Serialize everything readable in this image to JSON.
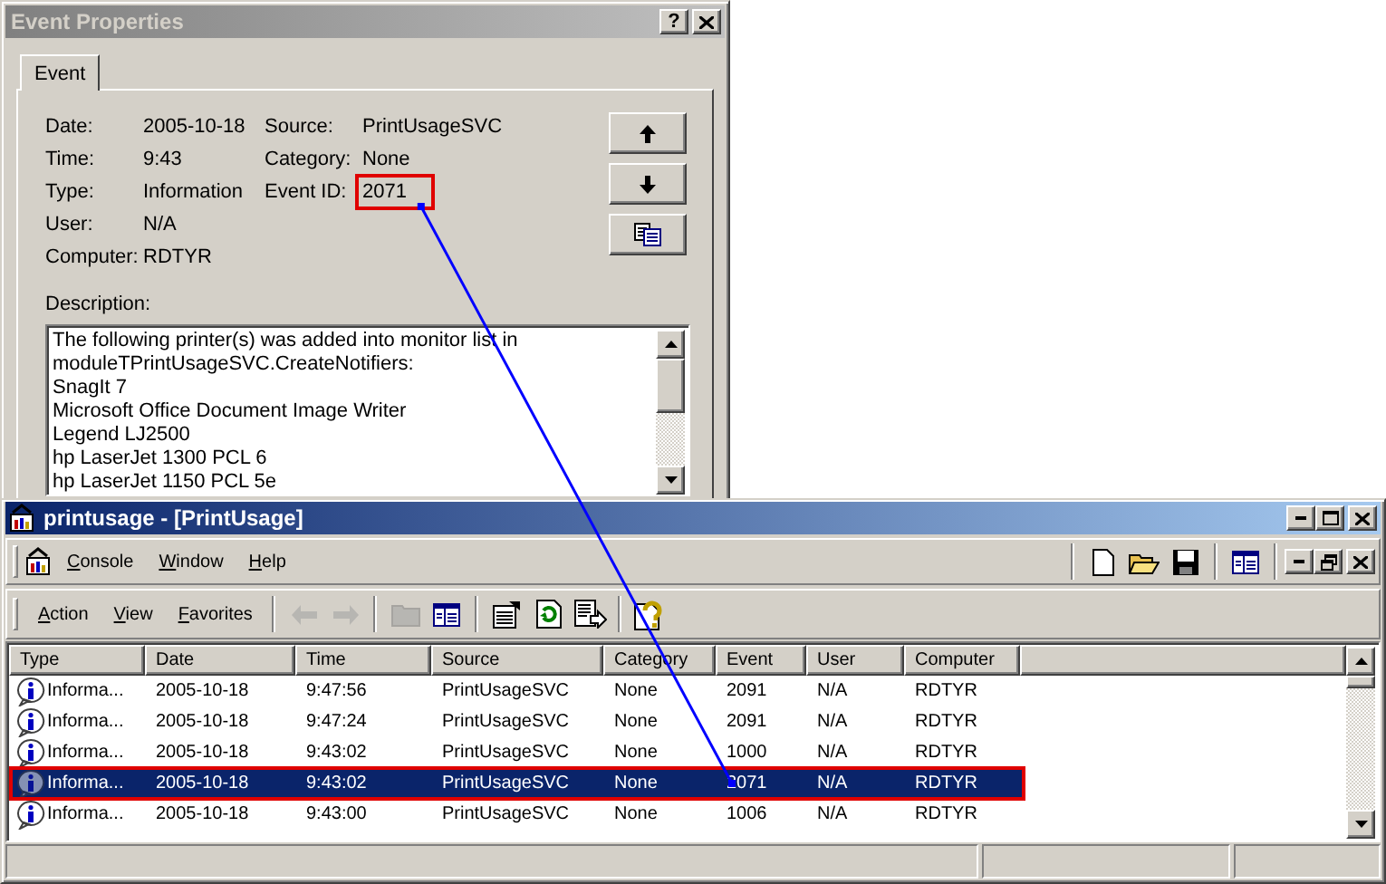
{
  "event_dialog": {
    "title": "Event Properties",
    "help_button": "?",
    "tabs": [
      {
        "label": "Event",
        "selected": true
      }
    ],
    "left_fields": [
      {
        "label": "Date:",
        "value": "2005-10-18",
        "highlighted": false
      },
      {
        "label": "Time:",
        "value": "9:43",
        "highlighted": false
      },
      {
        "label": "Type:",
        "value": "Information",
        "highlighted": false
      },
      {
        "label": "User:",
        "value": "N/A",
        "highlighted": false
      },
      {
        "label": "Computer:",
        "value": "RDTYR",
        "highlighted": false
      }
    ],
    "right_fields": [
      {
        "label": "Source:",
        "value": "PrintUsageSVC",
        "highlighted": false
      },
      {
        "label": "Category:",
        "value": "None",
        "highlighted": false
      },
      {
        "label": "Event ID:",
        "value": "2071",
        "highlighted": true
      }
    ],
    "side_buttons": [
      {
        "kind": "up"
      },
      {
        "kind": "down"
      },
      {
        "kind": "copy"
      }
    ],
    "description_label": "Description:",
    "description_lines": [
      "The following printer(s) was added into monitor list in",
      "moduleTPrintUsageSVC.CreateNotifiers:",
      "SnagIt 7",
      "Microsoft Office Document Image Writer",
      "Legend LJ2500",
      "hp LaserJet 1300 PCL 6",
      "hp LaserJet 1150 PCL 5e"
    ]
  },
  "main_window": {
    "title": "printusage - [PrintUsage]",
    "menu": [
      "Console",
      "Window",
      "Help"
    ],
    "right_toolbar": [
      {
        "kind": "new"
      },
      {
        "kind": "open"
      },
      {
        "kind": "save"
      },
      {
        "kind": "pane"
      }
    ],
    "action_menu": [
      "Action",
      "View",
      "Favorites"
    ],
    "toolbar": [
      {
        "kind": "back",
        "disabled": true
      },
      {
        "kind": "forward",
        "disabled": true
      },
      {
        "kind": "folder",
        "disabled": true
      },
      {
        "kind": "pane",
        "disabled": false
      },
      {
        "kind": "properties",
        "disabled": false
      },
      {
        "kind": "refresh",
        "disabled": false
      },
      {
        "kind": "export",
        "disabled": false
      },
      {
        "kind": "help",
        "disabled": false
      }
    ],
    "list": {
      "columns": [
        "Type",
        "Date",
        "Time",
        "Source",
        "Category",
        "Event",
        "User",
        "Computer"
      ],
      "rows": [
        {
          "cells": [
            "Informa...",
            "2005-10-18",
            "9:47:56",
            "PrintUsageSVC",
            "None",
            "2091",
            "N/A",
            "RDTYR"
          ],
          "selected": false,
          "highlighted": false
        },
        {
          "cells": [
            "Informa...",
            "2005-10-18",
            "9:47:24",
            "PrintUsageSVC",
            "None",
            "2091",
            "N/A",
            "RDTYR"
          ],
          "selected": false,
          "highlighted": false
        },
        {
          "cells": [
            "Informa...",
            "2005-10-18",
            "9:43:02",
            "PrintUsageSVC",
            "None",
            "1000",
            "N/A",
            "RDTYR"
          ],
          "selected": false,
          "highlighted": false
        },
        {
          "cells": [
            "Informa...",
            "2005-10-18",
            "9:43:02",
            "PrintUsageSVC",
            "None",
            "2071",
            "N/A",
            "RDTYR"
          ],
          "selected": true,
          "highlighted": true
        },
        {
          "cells": [
            "Informa...",
            "2005-10-18",
            "9:43:00",
            "PrintUsageSVC",
            "None",
            "1006",
            "N/A",
            "RDTYR"
          ],
          "selected": false,
          "highlighted": false
        }
      ]
    }
  }
}
